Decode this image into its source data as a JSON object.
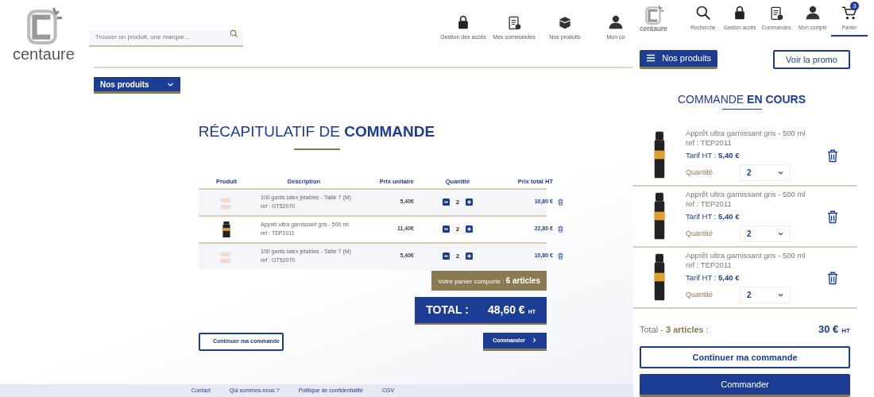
{
  "desktop": {
    "logo": "centaure",
    "search": {
      "placeholder": "Trouver un produit, une marque..."
    },
    "nav": [
      {
        "label": "Gestion des accès",
        "kind": "lock"
      },
      {
        "label": "Mes commandes",
        "kind": "clipboard"
      },
      {
        "label": "Nos produits",
        "kind": "box"
      },
      {
        "label": "Mon co",
        "kind": "person"
      }
    ],
    "menu_button": "Nos produits",
    "title": "RÉCAPITULATIF DE **COMMANDE**",
    "table": {
      "columns": [
        "Produit",
        "Description",
        "Prix unitaire",
        "Quantité",
        "Prix total HT"
      ],
      "rows": [
        {
          "kind": "glove",
          "description": "100 gants latex jetables - Taille 7 (M)",
          "ref": "ref : GT52070",
          "unit_price": "5,40€",
          "quantity": "2",
          "total": "10,80 €"
        },
        {
          "kind": "spray",
          "description": "Apprêt ultra garnissant gris - 500 ml",
          "ref": "ref : TEP2011",
          "unit_price": "11,40€",
          "quantity": "2",
          "total": "22,80 €"
        },
        {
          "kind": "glove",
          "description": "100 gants latex jetables - Taille 7 (M)",
          "ref": "ref : GT52070",
          "unit_price": "5,40€",
          "quantity": "2",
          "total": "10,80 €"
        }
      ]
    },
    "cart_count": "Votre panier comporte : **6 articles**",
    "total_label": "TOTAL :",
    "total_amount": "48,60 €",
    "total_unit": "HT",
    "continue_button": "Continuer ma commande",
    "order_button": "Commander",
    "footer": [
      "Contact",
      "Qui sommes-nous ?",
      "Politique de confidentialité",
      "CGV"
    ]
  },
  "mobile": {
    "logo": "centaure",
    "nav": [
      {
        "label": "Recherche",
        "kind": "search",
        "selected": false
      },
      {
        "label": "Gestion accès",
        "kind": "lock",
        "selected": false
      },
      {
        "label": "Commandes",
        "kind": "clipboard",
        "selected": false
      },
      {
        "label": "Mon compte",
        "kind": "person",
        "selected": false
      },
      {
        "label": "Panier",
        "kind": "cart",
        "selected": true,
        "badge": "3"
      }
    ],
    "menu_button": "Nos produits",
    "promo_button": "Voir la promo",
    "title": "COMMANDE **EN COURS**",
    "items": [
      {
        "name": "Apprêt ultra garnissant gris - 500 ml",
        "ref": "ref : TEP2011",
        "price": "Tarif HT : **5,40 €**",
        "quantity_label": "Quantité",
        "quantity": "2"
      },
      {
        "name": "Apprêt ultra garnissant gris - 500 ml",
        "ref": "ref : TEP2011",
        "price": "Tarif HT : **5,40 €**",
        "quantity_label": "Quantité",
        "quantity": "2"
      },
      {
        "name": "Apprêt ultra garnissant gris - 500 ml",
        "ref": "ref : TEP2011",
        "price": "Tarif HT : **5,40 €**",
        "quantity_label": "Quantité",
        "quantity": "2"
      }
    ],
    "total_label": "Total - **3 articles** :",
    "total_amount": "30 €",
    "total_unit": "HT",
    "continue_button": "Continuer ma commande",
    "order_button": "Commander"
  }
}
